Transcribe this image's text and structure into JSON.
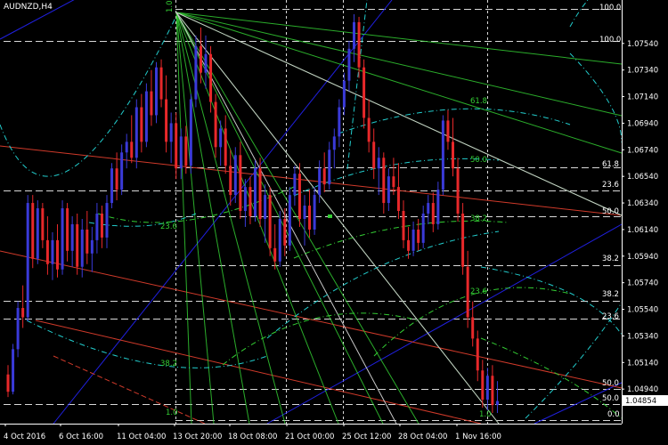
{
  "symbol_title": "AUDNZD,H4",
  "colors": {
    "background": "#000000",
    "bull": "#3a3ad8",
    "bear": "#e8282a",
    "fibo_green": "#33cc33",
    "fibo_cyan": "#22cccc",
    "trend_blue": "#2020e0",
    "channel_red": "#d03a2a",
    "grid": "#cccccc",
    "current_price_box": "#ffffff"
  },
  "chart_data": {
    "type": "candlestick",
    "symbol": "AUDNZD",
    "timeframe": "H4",
    "ylim": [
      1.0468,
      1.0784
    ],
    "y_ticks": [
      "1.07540",
      "1.07340",
      "1.07140",
      "1.06940",
      "1.06740",
      "1.06540",
      "1.06340",
      "1.06140",
      "1.05940",
      "1.05740",
      "1.05540",
      "1.05340",
      "1.05140",
      "1.04940"
    ],
    "x_ticks": [
      "4 Oct 2016",
      "6 Oct 16:00",
      "11 Oct 04:00",
      "13 Oct 20:00",
      "18 Oct 08:00",
      "21 Oct 00:00",
      "25 Oct 12:00",
      "28 Oct 04:00",
      "1 Nov 16:00"
    ],
    "current_price": "1.04854",
    "fibo_labels": {
      "levels_right": [
        "100.0",
        "100.0",
        "61.8",
        "23.6",
        "50.0",
        "38.2",
        "38.2",
        "23.6",
        "50.0",
        "50.0",
        "0.0"
      ],
      "arc_labels": [
        "61.8",
        "50.0",
        "38.2",
        "23.6",
        "23.6",
        "38.2",
        "1.0"
      ],
      "fan_anchor": "1.0",
      "bottom_label": "1.0"
    },
    "series": [
      {
        "ohlc": [
          [
            1.0505,
            1.0512,
            1.0488,
            1.0492
          ],
          [
            1.0492,
            1.0528,
            1.049,
            1.0524
          ],
          [
            1.0524,
            1.056,
            1.0518,
            1.0555
          ],
          [
            1.0555,
            1.0572,
            1.054,
            1.0548
          ],
          [
            1.0548,
            1.064,
            1.0545,
            1.0634
          ],
          [
            1.0634,
            1.064,
            1.0585,
            1.0592
          ],
          [
            1.0592,
            1.0636,
            1.0588,
            1.063
          ],
          [
            1.063,
            1.0634,
            1.06,
            1.0606
          ],
          [
            1.0606,
            1.0624,
            1.058,
            1.0588
          ],
          [
            1.0588,
            1.0612,
            1.0576,
            1.0606
          ],
          [
            1.0606,
            1.0618,
            1.0578,
            1.0584
          ],
          [
            1.0584,
            1.0636,
            1.058,
            1.063
          ],
          [
            1.063,
            1.0634,
            1.059,
            1.0598
          ],
          [
            1.0598,
            1.0624,
            1.0586,
            1.0618
          ],
          [
            1.0618,
            1.0626,
            1.058,
            1.0586
          ],
          [
            1.0586,
            1.0622,
            1.0578,
            1.0614
          ],
          [
            1.0614,
            1.0628,
            1.0588,
            1.0596
          ],
          [
            1.0596,
            1.0616,
            1.0582,
            1.0606
          ],
          [
            1.0606,
            1.0634,
            1.0596,
            1.0626
          ],
          [
            1.0626,
            1.0632,
            1.06,
            1.0608
          ],
          [
            1.0608,
            1.064,
            1.06,
            1.0634
          ],
          [
            1.0634,
            1.0664,
            1.063,
            1.066
          ],
          [
            1.066,
            1.0672,
            1.0636,
            1.0644
          ],
          [
            1.0644,
            1.0678,
            1.064,
            1.0672
          ],
          [
            1.0672,
            1.0686,
            1.066,
            1.068
          ],
          [
            1.068,
            1.07,
            1.0664,
            1.0668
          ],
          [
            1.0668,
            1.0712,
            1.066,
            1.0706
          ],
          [
            1.0706,
            1.0716,
            1.0672,
            1.068
          ],
          [
            1.068,
            1.0724,
            1.0676,
            1.0718
          ],
          [
            1.0718,
            1.0734,
            1.0692,
            1.07
          ],
          [
            1.07,
            1.074,
            1.0694,
            1.0736
          ],
          [
            1.0736,
            1.0742,
            1.0706,
            1.0712
          ],
          [
            1.0712,
            1.073,
            1.0672,
            1.068
          ],
          [
            1.068,
            1.0702,
            1.0664,
            1.0694
          ],
          [
            1.0694,
            1.0702,
            1.0652,
            1.066
          ],
          [
            1.066,
            1.069,
            1.0652,
            1.0684
          ],
          [
            1.0684,
            1.0692,
            1.0656,
            1.0662
          ],
          [
            1.0662,
            1.0716,
            1.0656,
            1.0712
          ],
          [
            1.0712,
            1.076,
            1.0706,
            1.0752
          ],
          [
            1.0752,
            1.0766,
            1.0724,
            1.0732
          ],
          [
            1.0732,
            1.076,
            1.072,
            1.0746
          ],
          [
            1.0746,
            1.0752,
            1.0702,
            1.071
          ],
          [
            1.071,
            1.0716,
            1.0668,
            1.0676
          ],
          [
            1.0676,
            1.0696,
            1.0662,
            1.069
          ],
          [
            1.069,
            1.07,
            1.0656,
            1.0662
          ],
          [
            1.0662,
            1.0674,
            1.0632,
            1.064
          ],
          [
            1.064,
            1.0676,
            1.0634,
            1.067
          ],
          [
            1.067,
            1.068,
            1.0622,
            1.0628
          ],
          [
            1.0628,
            1.0652,
            1.0616,
            1.0646
          ],
          [
            1.0646,
            1.0654,
            1.0618,
            1.0624
          ],
          [
            1.0624,
            1.0666,
            1.062,
            1.066
          ],
          [
            1.066,
            1.0668,
            1.0616,
            1.0622
          ],
          [
            1.0622,
            1.0648,
            1.0604,
            1.064
          ],
          [
            1.064,
            1.0646,
            1.0594,
            1.06
          ],
          [
            1.06,
            1.0618,
            1.0584,
            1.059
          ],
          [
            1.059,
            1.0628,
            1.0586,
            1.0622
          ],
          [
            1.0622,
            1.063,
            1.0594,
            1.0602
          ],
          [
            1.0602,
            1.0646,
            1.0598,
            1.064
          ],
          [
            1.064,
            1.0662,
            1.0632,
            1.0656
          ],
          [
            1.0656,
            1.0664,
            1.0616,
            1.0622
          ],
          [
            1.0622,
            1.064,
            1.0602,
            1.0632
          ],
          [
            1.0632,
            1.0644,
            1.0608,
            1.0614
          ],
          [
            1.0614,
            1.0646,
            1.061,
            1.064
          ],
          [
            1.064,
            1.0666,
            1.0634,
            1.066
          ],
          [
            1.066,
            1.0672,
            1.0642,
            1.0648
          ],
          [
            1.0648,
            1.068,
            1.0644,
            1.0674
          ],
          [
            1.0674,
            1.069,
            1.066,
            1.0684
          ],
          [
            1.0684,
            1.0712,
            1.0676,
            1.0706
          ],
          [
            1.0706,
            1.0732,
            1.07,
            1.0726
          ],
          [
            1.0726,
            1.0756,
            1.0718,
            1.075
          ],
          [
            1.075,
            1.0776,
            1.074,
            1.077
          ],
          [
            1.077,
            1.0774,
            1.0728,
            1.0736
          ],
          [
            1.0736,
            1.0742,
            1.069,
            1.0698
          ],
          [
            1.0698,
            1.0712,
            1.0672,
            1.068
          ],
          [
            1.068,
            1.069,
            1.0652,
            1.066
          ],
          [
            1.066,
            1.0676,
            1.064,
            1.0668
          ],
          [
            1.0668,
            1.0672,
            1.0626,
            1.0634
          ],
          [
            1.0634,
            1.066,
            1.0628,
            1.0654
          ],
          [
            1.0654,
            1.0668,
            1.064,
            1.0646
          ],
          [
            1.0646,
            1.0664,
            1.0622,
            1.0628
          ],
          [
            1.0628,
            1.0636,
            1.06,
            1.0606
          ],
          [
            1.0606,
            1.0616,
            1.0592,
            1.0598
          ],
          [
            1.0598,
            1.062,
            1.0594,
            1.0614
          ],
          [
            1.0614,
            1.0622,
            1.0598,
            1.0604
          ],
          [
            1.0604,
            1.0632,
            1.06,
            1.0626
          ],
          [
            1.0626,
            1.064,
            1.0618,
            1.0634
          ],
          [
            1.0634,
            1.0642,
            1.0612,
            1.0618
          ],
          [
            1.0618,
            1.065,
            1.0614,
            1.0644
          ],
          [
            1.0644,
            1.07,
            1.064,
            1.0696
          ],
          [
            1.0696,
            1.0704,
            1.0674,
            1.068
          ],
          [
            1.068,
            1.0698,
            1.0654,
            1.066
          ],
          [
            1.066,
            1.0668,
            1.062,
            1.0626
          ],
          [
            1.0626,
            1.0634,
            1.058,
            1.0586
          ],
          [
            1.0586,
            1.0598,
            1.054,
            1.0548
          ],
          [
            1.0548,
            1.056,
            1.0526,
            1.0532
          ],
          [
            1.0532,
            1.0538,
            1.05,
            1.0508
          ],
          [
            1.0508,
            1.0516,
            1.048,
            1.0486
          ],
          [
            1.0486,
            1.051,
            1.0478,
            1.0504
          ],
          [
            1.0504,
            1.0512,
            1.0476,
            1.0482
          ],
          [
            1.0482,
            1.05,
            1.0476,
            1.0485
          ]
        ]
      }
    ]
  }
}
